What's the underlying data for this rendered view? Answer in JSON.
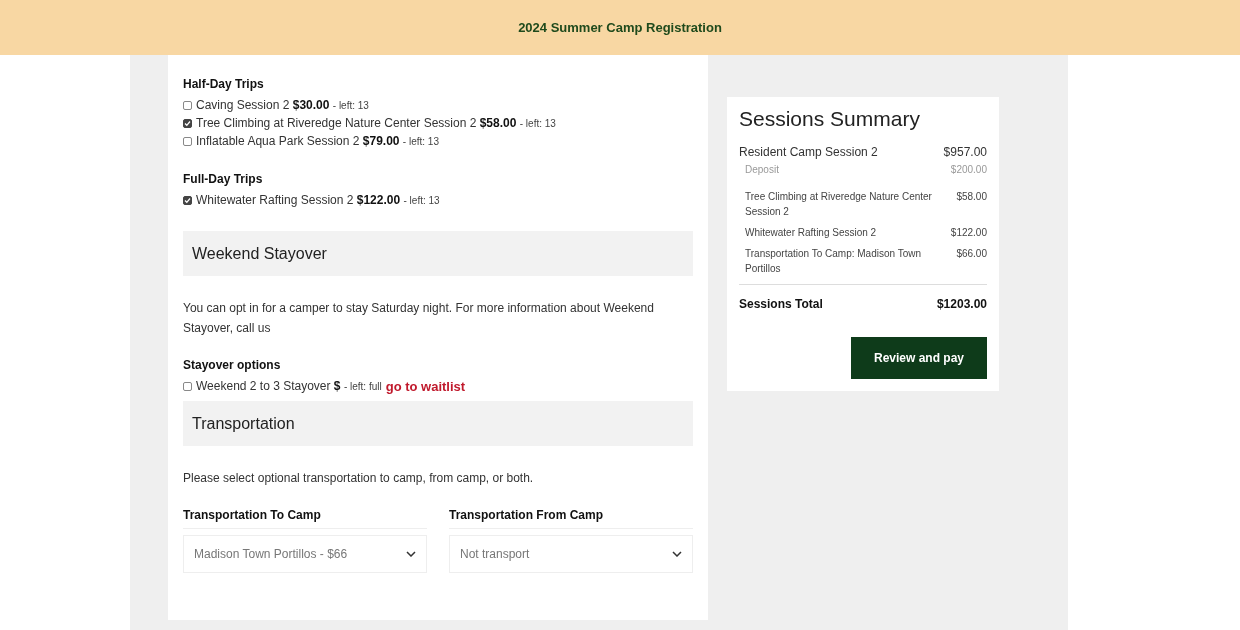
{
  "header": {
    "title": "2024 Summer Camp Registration"
  },
  "form": {
    "groups": [
      {
        "kind": "options",
        "title": "Half-Day Trips",
        "options": [
          {
            "label": "Caving Session 2",
            "price": "$30.00",
            "availability": "- left: 13",
            "checked": false
          },
          {
            "label": "Tree Climbing at Riveredge Nature Center Session 2",
            "price": "$58.00",
            "availability": "- left: 13",
            "checked": true
          },
          {
            "label": "Inflatable Aqua Park Session 2",
            "price": "$79.00",
            "availability": "- left: 13",
            "checked": false
          }
        ]
      },
      {
        "kind": "options",
        "title": "Full-Day Trips",
        "options": [
          {
            "label": "Whitewater Rafting Session 2",
            "price": "$122.00",
            "availability": "- left: 13",
            "checked": true
          }
        ]
      },
      {
        "kind": "section",
        "title": "Weekend Stayover"
      },
      {
        "kind": "text",
        "text": "You can opt in for a camper to stay Saturday night. For more information about Weekend Stayover, call us"
      },
      {
        "kind": "options",
        "title": "Stayover options",
        "options": [
          {
            "label": "Weekend 2 to 3 Stayover",
            "price": "$",
            "availability": "- left: full",
            "checked": false,
            "link": "go to waitlist"
          }
        ]
      },
      {
        "kind": "section",
        "title": "Transportation"
      },
      {
        "kind": "text",
        "text": "Please select optional transportation to camp, from camp, or both."
      },
      {
        "kind": "selects",
        "fields": [
          {
            "label": "Transportation To Camp",
            "value": "Madison Town Portillos - $66"
          },
          {
            "label": "Transportation From Camp",
            "value": "Not transport"
          }
        ]
      }
    ]
  },
  "summary": {
    "title": "Sessions Summary",
    "lines": [
      {
        "kind": "main",
        "name": "Resident Camp Session 2",
        "amount": "$957.00"
      },
      {
        "kind": "minor",
        "name": "Deposit",
        "amount": "$200.00"
      },
      {
        "kind": "item",
        "name": "Tree Climbing at Riveredge Nature Center Session 2",
        "amount": "$58.00"
      },
      {
        "kind": "item",
        "name": "Whitewater Rafting Session 2",
        "amount": "$122.00"
      },
      {
        "kind": "item",
        "name": "Transportation To Camp: Madison Town Portillos",
        "amount": "$66.00"
      }
    ],
    "total_label": "Sessions Total",
    "total": "$1203.00",
    "button": "Review and pay"
  }
}
